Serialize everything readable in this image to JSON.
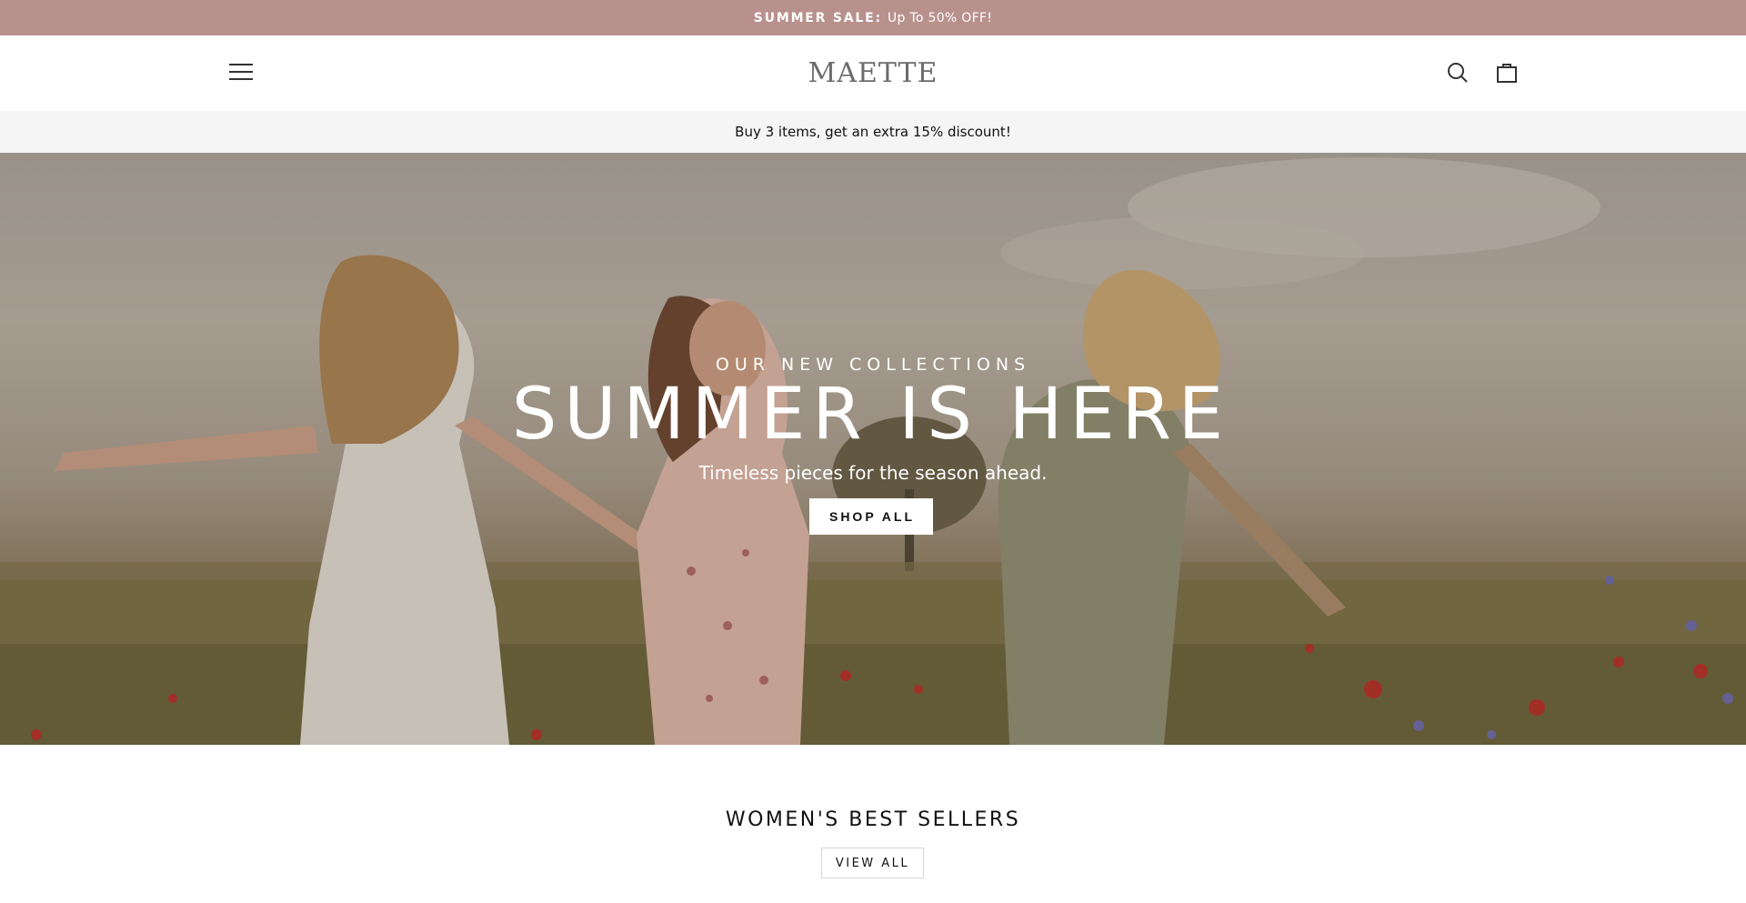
{
  "announcement": {
    "bold": "SUMMER SALE:",
    "text": "Up To 50% OFF!"
  },
  "header": {
    "logo": "MAETTE",
    "icons": [
      "menu-icon",
      "search-icon",
      "shopping-bag-icon"
    ]
  },
  "promo": {
    "text": "Buy 3 items, get an extra 15% discount!"
  },
  "hero": {
    "eyebrow": "OUR NEW COLLECTIONS",
    "title": "SUMMER IS HERE",
    "subtitle": "Timeless pieces for the season ahead.",
    "cta": "SHOP ALL"
  },
  "best_sellers": {
    "title": "WOMEN'S BEST SELLERS",
    "cta": "VIEW ALL"
  },
  "colors": {
    "announcement_bg": "#b8918d",
    "promo_bg": "#f5f5f5",
    "logo": "#6b6b6b"
  }
}
